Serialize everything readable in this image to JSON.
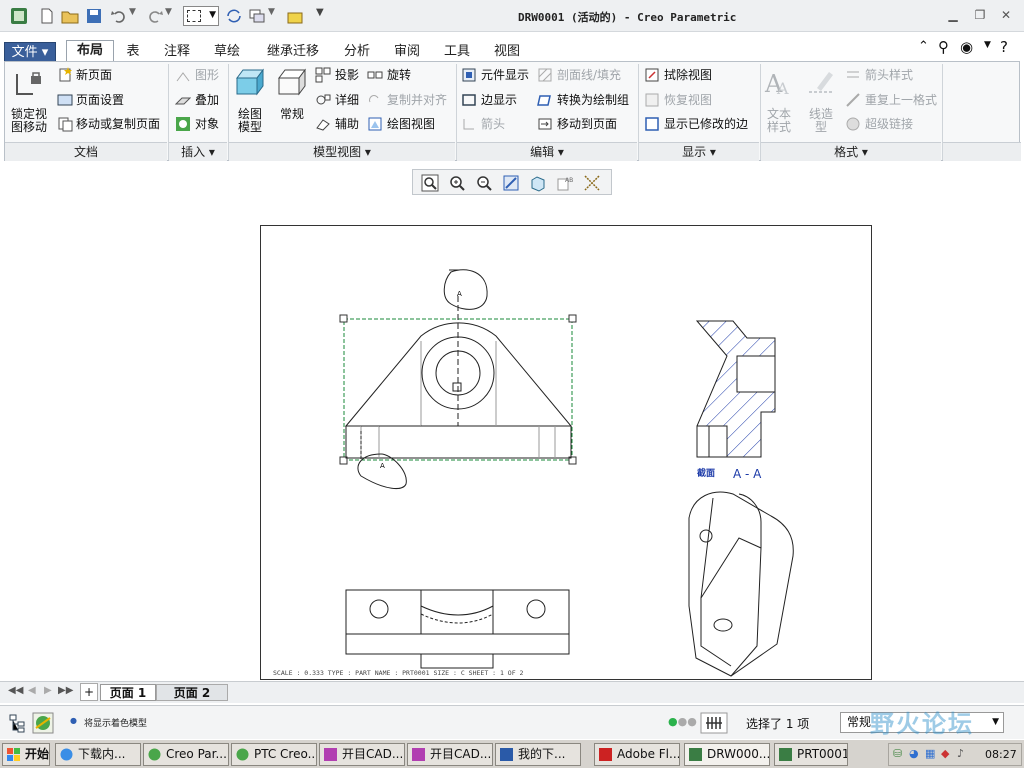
{
  "window": {
    "title": "DRW0001 (活动的) - Creo Parametric"
  },
  "tabs": [
    "文件",
    "布局",
    "表",
    "注释",
    "草绘",
    "继承迁移",
    "分析",
    "审阅",
    "工具",
    "视图"
  ],
  "active_tab": "布局",
  "ribbon": {
    "doc": {
      "lock": "锁定视\n图移动",
      "new_page": "新页面",
      "page_setup": "页面设置",
      "move_copy": "移动或复制页面",
      "group": "文档"
    },
    "insert": {
      "shape": "图形",
      "overlay": "叠加",
      "object": "对象",
      "group": "插入"
    },
    "model_views": {
      "drawing_model": "绘图\n模型",
      "general": "常规",
      "projection": "投影",
      "detail": "详细",
      "auxiliary": "辅助",
      "revolve": "旋转",
      "copy_align": "复制并对齐",
      "drawing_view": "绘图视图",
      "group": "模型视图"
    },
    "edit": {
      "component_display": "元件显示",
      "edge_display": "边显示",
      "arrow": "箭头",
      "xhatch": "剖面线/填充",
      "convert": "转换为绘制组",
      "move_to_page": "移动到页面",
      "group": "编辑"
    },
    "display": {
      "erase_view": "拭除视图",
      "restore_view": "恢复视图",
      "show_modified": "显示已修改的边",
      "group": "显示"
    },
    "format": {
      "text_style": "文本\n样式",
      "line_style": "线造\n型",
      "arrow_style": "箭头样式",
      "repeat_format": "重复上一格式",
      "hyperlink": "超级链接",
      "group": "格式"
    }
  },
  "view_toolbar": [
    "zoom-fit",
    "zoom-in",
    "zoom-out",
    "repaint",
    "display-style",
    "annotation-display",
    "datum-display"
  ],
  "drawing": {
    "section_label": "截面",
    "section_name": "A - A",
    "cut_label_top": "A",
    "cut_label_bottom": "A",
    "sheet_info": "SCALE : 0.333    TYPE : PART    NAME : PRT0001    SIZE : C    SHEET : 1 OF 2"
  },
  "pages": [
    "页面 1",
    "页面 2"
  ],
  "status": {
    "message": "将显示着色模型",
    "selection": "选择了 1 项",
    "filter": "常规"
  },
  "taskbar": {
    "start": "开始",
    "items": [
      "下载内...",
      "Creo Par...",
      "PTC Creo...",
      "开目CAD...",
      "开目CAD...",
      "我的下...",
      "Adobe Fl...",
      "DRW000...",
      "PRT0001"
    ],
    "clock": "08:27"
  },
  "watermark": "野火论坛",
  "colors": {
    "accent": "#2f5fb3",
    "hatch": "#1c3aa8",
    "selection": "#1a8a3a"
  }
}
